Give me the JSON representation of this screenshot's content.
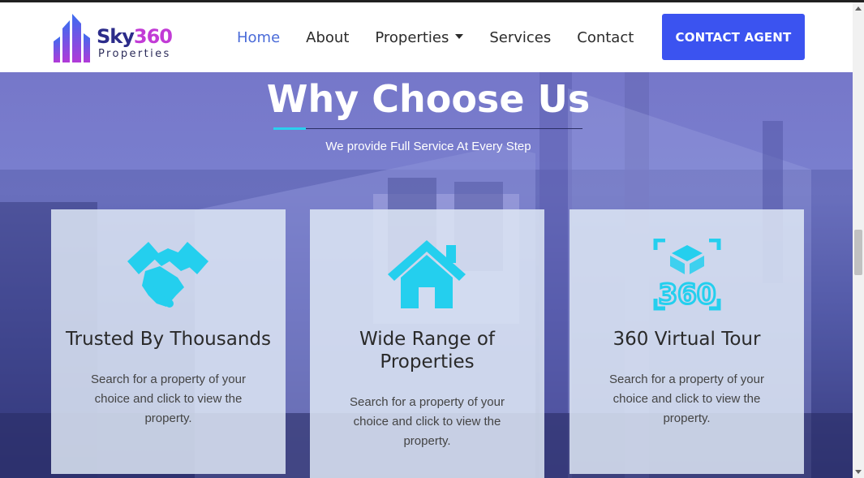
{
  "brand": {
    "name_part1": "Sky",
    "name_part2": "360",
    "tagline": "Properties",
    "color_primary": "#2c2c8a",
    "color_accent": "#c23bd6"
  },
  "nav": {
    "items": [
      {
        "label": "Home",
        "active": true
      },
      {
        "label": "About"
      },
      {
        "label": "Properties",
        "dropdown": true
      },
      {
        "label": "Services"
      },
      {
        "label": "Contact"
      }
    ],
    "cta_label": "CONTACT AGENT",
    "cta_color": "#3b53f0"
  },
  "hero": {
    "title": "Why Choose Us",
    "subtitle": "We provide Full Service At Every Step",
    "accent_color": "#2ad0ef"
  },
  "cards": [
    {
      "icon": "handshake-icon",
      "title": "Trusted By Thousands",
      "text_lines": [
        "Search for a property of your",
        "choice and click to view the",
        "property."
      ]
    },
    {
      "icon": "house-icon",
      "title_lines": [
        "Wide Range of",
        "Properties"
      ],
      "text_lines": [
        "Search for a property of your",
        "choice and click to view the",
        "property."
      ]
    },
    {
      "icon": "360-tour-icon",
      "title": "360 Virtual Tour",
      "text_lines": [
        "Search for a property of your",
        "choice and click to view the",
        "property."
      ]
    }
  ]
}
